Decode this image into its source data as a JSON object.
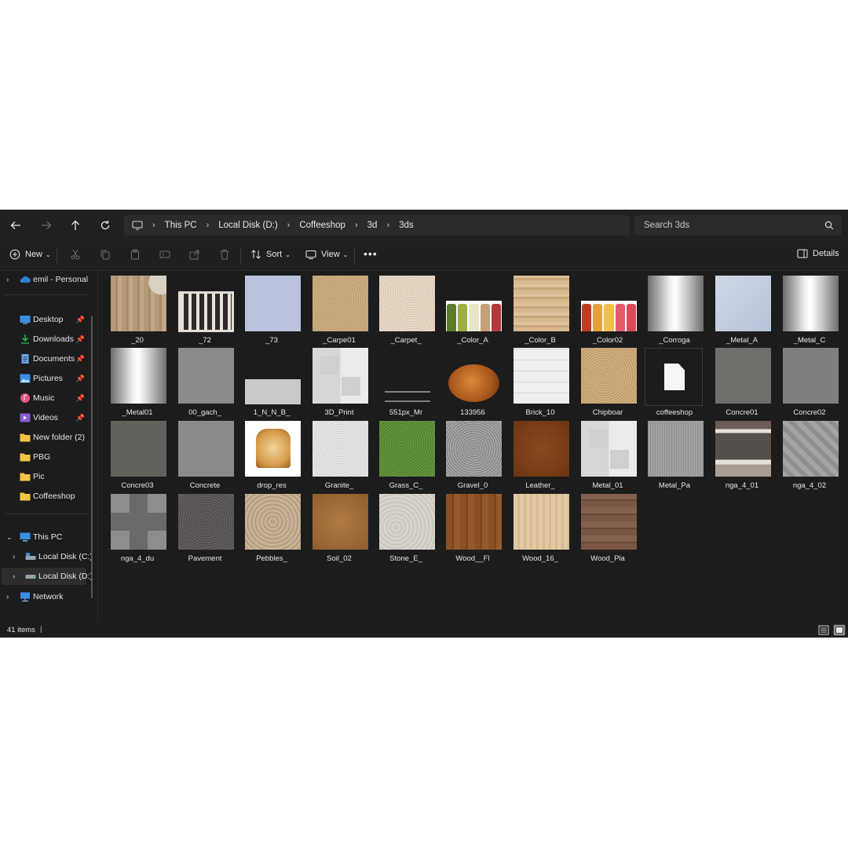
{
  "nav": {
    "breadcrumb": [
      "This PC",
      "Local Disk (D:)",
      "Coffeeshop",
      "3d",
      "3ds"
    ],
    "search_placeholder": "Search 3ds"
  },
  "toolbar": {
    "new_label": "New",
    "sort_label": "Sort",
    "view_label": "View",
    "details_label": "Details"
  },
  "sidebar": {
    "onedrive": "emil - Personal",
    "quick": [
      {
        "label": "Desktop",
        "icon": "desktop-icon",
        "pinned": true
      },
      {
        "label": "Downloads",
        "icon": "download-icon",
        "pinned": true
      },
      {
        "label": "Documents",
        "icon": "document-icon",
        "pinned": true
      },
      {
        "label": "Pictures",
        "icon": "picture-icon",
        "pinned": true
      },
      {
        "label": "Music",
        "icon": "music-icon",
        "pinned": true
      },
      {
        "label": "Videos",
        "icon": "video-icon",
        "pinned": true
      },
      {
        "label": "New folder (2)",
        "icon": "folder-icon",
        "pinned": false
      },
      {
        "label": "PBG",
        "icon": "folder-icon",
        "pinned": false
      },
      {
        "label": "Pic",
        "icon": "folder-icon",
        "pinned": false
      },
      {
        "label": "Coffeeshop",
        "icon": "folder-icon",
        "pinned": false
      }
    ],
    "this_pc": "This PC",
    "drives": [
      "Local Disk (C:)",
      "Local Disk (D:)"
    ],
    "network": "Network"
  },
  "files": [
    {
      "name": "_20",
      "thumb": "wood-round"
    },
    {
      "name": "_72",
      "thumb": "grate"
    },
    {
      "name": "_73",
      "thumb": "blue-tile"
    },
    {
      "name": "_Carpe01",
      "thumb": "carpet"
    },
    {
      "name": "_Carpet_",
      "thumb": "carpet-light"
    },
    {
      "name": "_Color_A",
      "thumb": "bottles-green"
    },
    {
      "name": "_Color_B",
      "thumb": "wood-light"
    },
    {
      "name": "_Color02",
      "thumb": "bottles-red"
    },
    {
      "name": "_Corroga",
      "thumb": "metal-grad"
    },
    {
      "name": "_Metal_A",
      "thumb": "metal-blue"
    },
    {
      "name": "_Metal_C",
      "thumb": "metal-grad"
    },
    {
      "name": "_Metal01",
      "thumb": "metal-grad"
    },
    {
      "name": "00_gach_",
      "thumb": "concrete-gray"
    },
    {
      "name": "1_N_N_B_",
      "thumb": "gray-strip"
    },
    {
      "name": "3D_Print",
      "thumb": "checker"
    },
    {
      "name": "551px_Mr",
      "thumb": "logo"
    },
    {
      "name": "133956",
      "thumb": "bread"
    },
    {
      "name": "Brick_10",
      "thumb": "brick-white"
    },
    {
      "name": "Chipboar",
      "thumb": "chipboard"
    },
    {
      "name": "coffeeshop",
      "thumb": "file"
    },
    {
      "name": "Concre01",
      "thumb": "concrete-dark"
    },
    {
      "name": "Concre02",
      "thumb": "concrete-mid"
    },
    {
      "name": "Concre03",
      "thumb": "concrete-dark2"
    },
    {
      "name": "Concrete",
      "thumb": "concrete-gray"
    },
    {
      "name": "drop_res",
      "thumb": "toast"
    },
    {
      "name": "Granite_",
      "thumb": "granite"
    },
    {
      "name": "Grass_C_",
      "thumb": "grass"
    },
    {
      "name": "Gravel_0",
      "thumb": "gravel"
    },
    {
      "name": "Leather_",
      "thumb": "leather"
    },
    {
      "name": "Metal_01",
      "thumb": "checker"
    },
    {
      "name": "Metal_Pa",
      "thumb": "metal-lines"
    },
    {
      "name": "nga_4_01",
      "thumb": "road"
    },
    {
      "name": "nga_4_02",
      "thumb": "paving"
    },
    {
      "name": "nga_4_du",
      "thumb": "intersection"
    },
    {
      "name": "Pavement",
      "thumb": "pavement"
    },
    {
      "name": "Pebbles_",
      "thumb": "pebbles"
    },
    {
      "name": "Soil_02",
      "thumb": "soil"
    },
    {
      "name": "Stone_E_",
      "thumb": "stone"
    },
    {
      "name": "Wood__Fl",
      "thumb": "wood-floor"
    },
    {
      "name": "Wood_16_",
      "thumb": "wood-light2"
    },
    {
      "name": "Wood_Pla",
      "thumb": "wood-plank"
    }
  ],
  "status": {
    "count": "41 items",
    "view_mode": "large-icons"
  }
}
